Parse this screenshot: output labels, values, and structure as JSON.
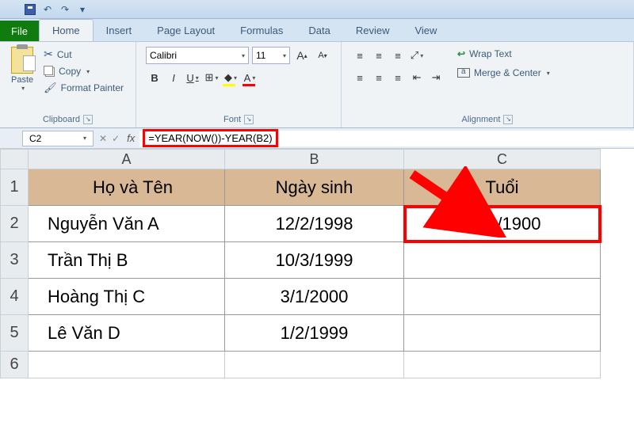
{
  "qat": {
    "undo": "↶",
    "redo": "↷",
    "dropdown": "▾"
  },
  "tabs": {
    "file": "File",
    "items": [
      "Home",
      "Insert",
      "Page Layout",
      "Formulas",
      "Data",
      "Review",
      "View"
    ],
    "active": "Home"
  },
  "ribbon": {
    "clipboard": {
      "paste": "Paste",
      "cut": "Cut",
      "copy": "Copy",
      "format_painter": "Format Painter",
      "label": "Clipboard"
    },
    "font": {
      "name": "Calibri",
      "size": "11",
      "bold": "B",
      "italic": "I",
      "underline": "U",
      "label": "Font"
    },
    "alignment": {
      "wrap": "Wrap Text",
      "merge": "Merge & Center",
      "label": "Alignment"
    }
  },
  "formula_bar": {
    "cell_ref": "C2",
    "formula": "=YEAR(NOW())-YEAR(B2)"
  },
  "sheet": {
    "columns": [
      "A",
      "B",
      "C"
    ],
    "headers": {
      "A": "Họ và Tên",
      "B": "Ngày sinh",
      "C": "Tuổi"
    },
    "rows": [
      {
        "n": "1"
      },
      {
        "n": "2",
        "A": "Nguyễn Văn A",
        "B": "12/2/1998",
        "C": "1/23/1900"
      },
      {
        "n": "3",
        "A": "Trần Thị B",
        "B": "10/3/1999",
        "C": ""
      },
      {
        "n": "4",
        "A": "Hoàng Thị C",
        "B": "3/1/2000",
        "C": ""
      },
      {
        "n": "5",
        "A": "Lê Văn D",
        "B": "1/2/1999",
        "C": ""
      },
      {
        "n": "6"
      }
    ]
  }
}
